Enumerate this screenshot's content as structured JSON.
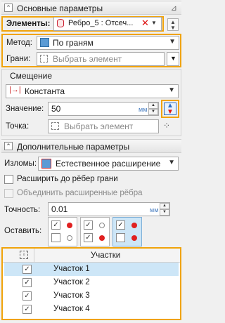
{
  "sections": {
    "main_title": "Основные параметры",
    "offset_title": "Смещение",
    "extra_title": "Дополнительные параметры"
  },
  "elements": {
    "label": "Элементы:",
    "value": "Ребро_5 : Отсеч..."
  },
  "method": {
    "label": "Метод:",
    "value": "По граням"
  },
  "faces": {
    "label": "Грани:",
    "placeholder": "Выбрать элемент"
  },
  "offset": {
    "type_value": "Константа",
    "value_label": "Значение:",
    "value": "50",
    "unit": "мм",
    "point_label": "Точка:",
    "point_placeholder": "Выбрать элемент"
  },
  "breaks": {
    "label": "Изломы:",
    "value": "Естественное расширение"
  },
  "checkboxes": {
    "extend_label": "Расширить до рёбер грани",
    "merge_label": "Объединить расширенные рёбра"
  },
  "accuracy": {
    "label": "Точность:",
    "value": "0.01",
    "unit": "мм"
  },
  "keep": {
    "label": "Оставить:"
  },
  "table": {
    "header": "Участки",
    "rows": [
      "Участок 1",
      "Участок 2",
      "Участок 3",
      "Участок 4"
    ]
  },
  "colors": {
    "highlight": "#f0a30a",
    "selection": "#cde6f7",
    "accent": "#2b6cc4",
    "marker_red": "#e02020"
  }
}
